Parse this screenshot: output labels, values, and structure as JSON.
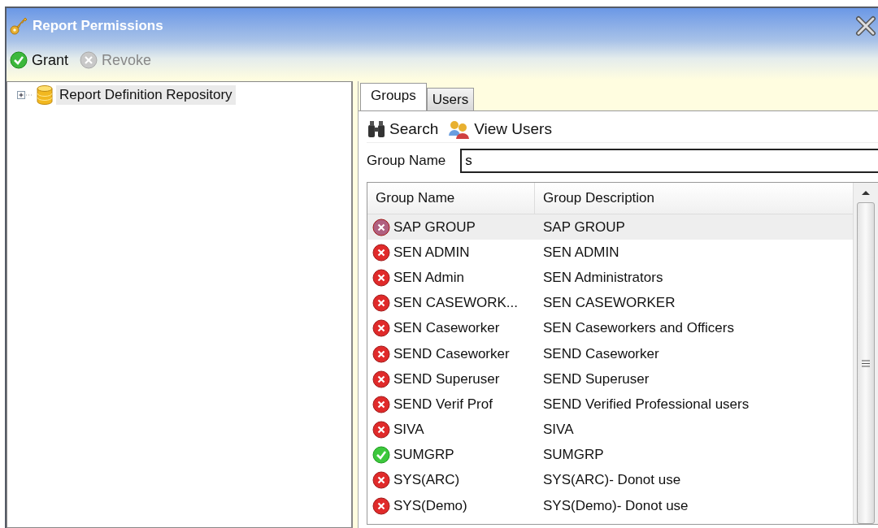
{
  "window": {
    "title": "Report Permissions"
  },
  "toolbar": [
    {
      "label": "Grant",
      "kind": "grant",
      "disabled": false
    },
    {
      "label": "Revoke",
      "kind": "revoke",
      "disabled": true
    }
  ],
  "tree": [
    {
      "label": "Report Definition Repository",
      "expanded": false,
      "selected": true
    }
  ],
  "tabs": [
    {
      "label": "Groups",
      "selected": true
    },
    {
      "label": "Users",
      "selected": false
    }
  ],
  "actions": [
    {
      "label": "Search",
      "kind": "search"
    },
    {
      "label": "View Users",
      "kind": "users"
    }
  ],
  "search": {
    "label": "Group Name",
    "value": "s"
  },
  "table": {
    "columns": [
      "Group Name",
      "Group Description"
    ],
    "rows": [
      {
        "name": "SAP GROUP",
        "description": "SAP GROUP",
        "granted": false,
        "selected": true
      },
      {
        "name": "SEN ADMIN",
        "description": "SEN ADMIN",
        "granted": false,
        "selected": false
      },
      {
        "name": "SEN Admin",
        "description": "SEN Administrators",
        "granted": false,
        "selected": false
      },
      {
        "name": "SEN CASEWORK...",
        "description": "SEN CASEWORKER",
        "granted": false,
        "selected": false
      },
      {
        "name": "SEN Caseworker",
        "description": "SEN Caseworkers and Officers",
        "granted": false,
        "selected": false
      },
      {
        "name": "SEND Caseworker",
        "description": "SEND Caseworker",
        "granted": false,
        "selected": false
      },
      {
        "name": "SEND Superuser",
        "description": "SEND Superuser",
        "granted": false,
        "selected": false
      },
      {
        "name": "SEND Verif Prof",
        "description": "SEND Verified Professional users",
        "granted": false,
        "selected": false
      },
      {
        "name": "SIVA",
        "description": "SIVA",
        "granted": false,
        "selected": false
      },
      {
        "name": "SUMGRP",
        "description": "SUMGRP",
        "granted": true,
        "selected": false
      },
      {
        "name": "SYS(ARC)",
        "description": "SYS(ARC)- Donot use",
        "granted": false,
        "selected": false
      },
      {
        "name": "SYS(Demo)",
        "description": "SYS(Demo)- Donot use",
        "granted": false,
        "selected": false
      }
    ]
  }
}
